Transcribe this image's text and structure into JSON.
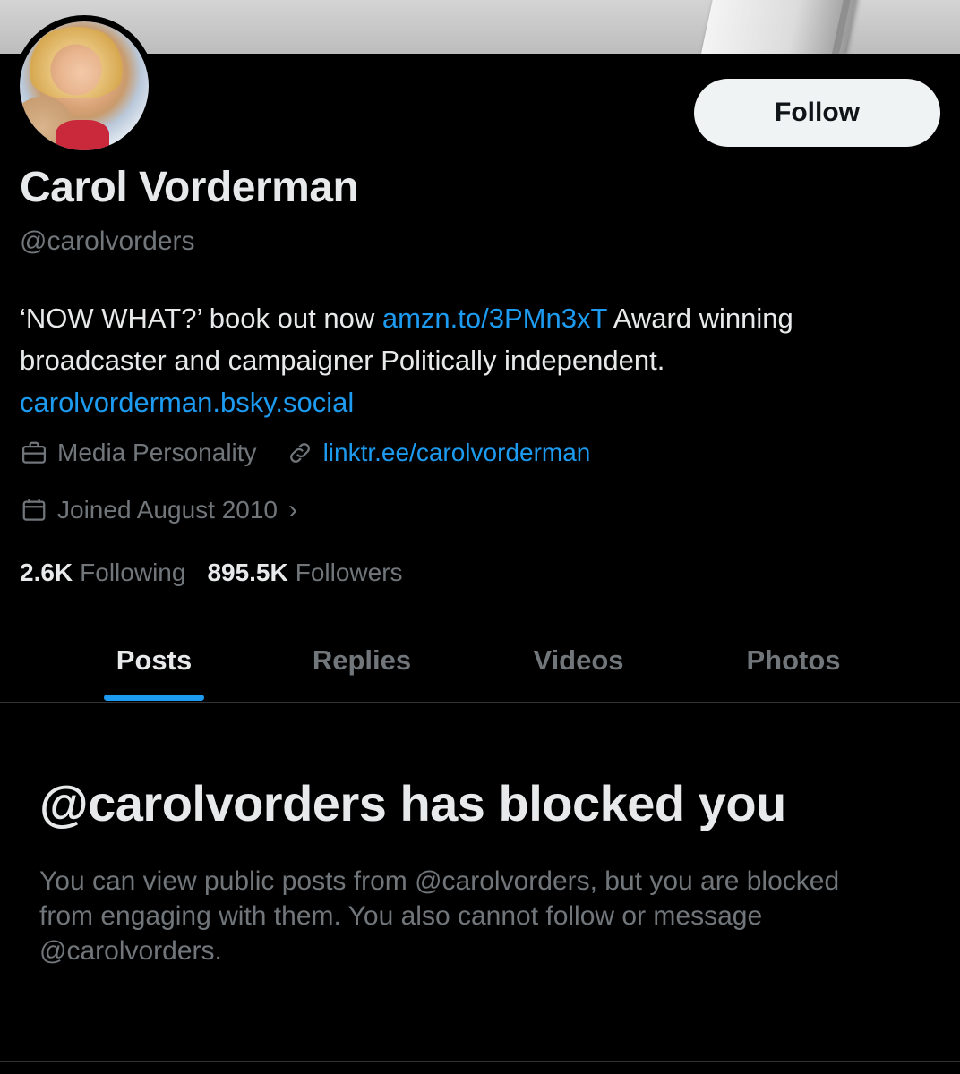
{
  "profile": {
    "name": "Carol Vorderman",
    "handle": "@carolvorders",
    "follow_label": "Follow",
    "bio": {
      "part1": "‘NOW WHAT?’ book out now ",
      "link1": "amzn.to/3PMn3xT",
      "part2": " Award winning broadcaster and campaigner Politically independent.",
      "link2": "carolvorderman.bsky.social"
    },
    "category": "Media Personality",
    "website": "linktr.ee/carolvorderman",
    "joined": "Joined August 2010",
    "following_count": "2.6K",
    "following_label": "Following",
    "followers_count": "895.5K",
    "followers_label": "Followers"
  },
  "tabs": [
    {
      "label": "Posts",
      "active": true
    },
    {
      "label": "Replies",
      "active": false
    },
    {
      "label": "Videos",
      "active": false
    },
    {
      "label": "Photos",
      "active": false
    }
  ],
  "blocked": {
    "title": "@carolvorders has blocked you",
    "message": "You can view public posts from @carolvorders, but you are blocked from engaging with them. You also cannot follow or message @carolvorders."
  },
  "icons": {
    "category": "briefcase-icon",
    "website": "link-icon",
    "joined": "calendar-icon",
    "joined_chevron": "chevron-right-icon"
  },
  "colors": {
    "background": "#000000",
    "text_primary": "#e7e9ea",
    "text_secondary": "#71767b",
    "accent": "#1d9bf0"
  }
}
